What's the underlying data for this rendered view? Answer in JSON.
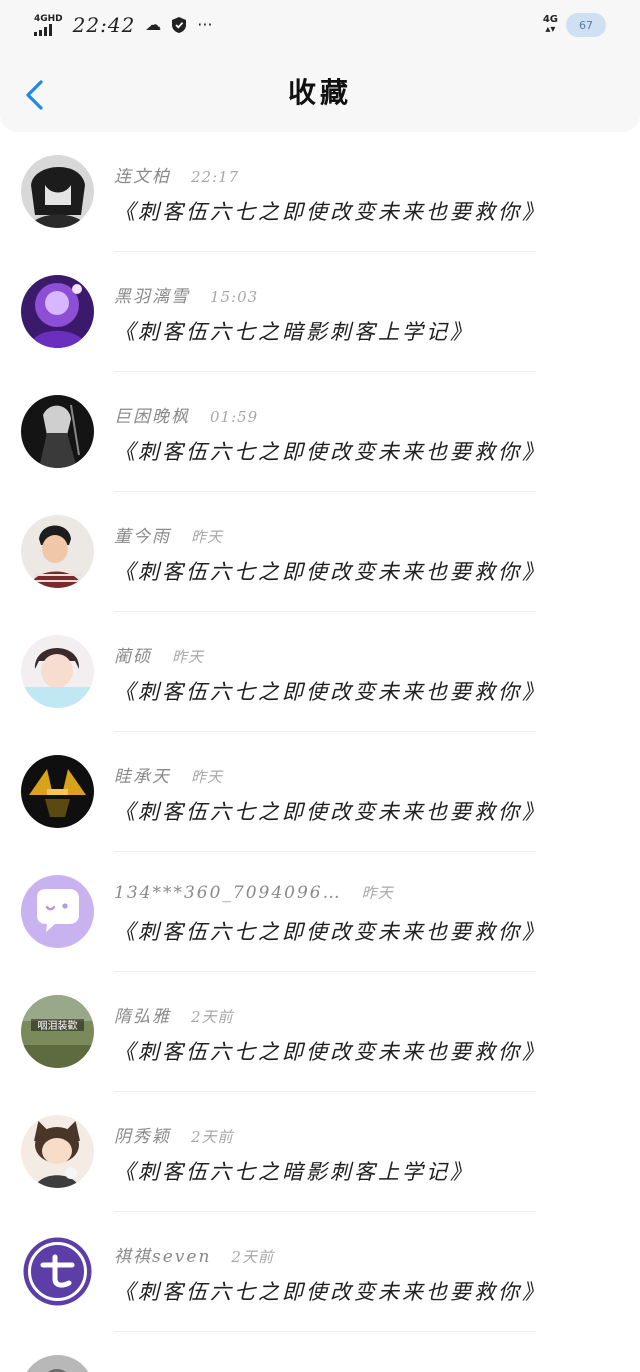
{
  "status_bar": {
    "network_left": "4GHD",
    "time": "22:42",
    "more": "···",
    "network_right": "4G",
    "battery": "67"
  },
  "header": {
    "title": "收藏"
  },
  "colors": {
    "accent": "#1e88e5",
    "divider": "#eeeeee"
  },
  "favorites": [
    {
      "name": "连文柏",
      "time": "22:17",
      "content": "《刺客伍六七之即使改变未来也要救你》",
      "avatar": "dark-anime-avatar"
    },
    {
      "name": "黑羽漓雪",
      "time": "15:03",
      "content": "《刺客伍六七之暗影刺客上学记》",
      "avatar": "purple-anime-avatar"
    },
    {
      "name": "巨困晚枫",
      "time": "01:59",
      "content": "《刺客伍六七之即使改变未来也要救你》",
      "avatar": "dark-figure-avatar"
    },
    {
      "name": "董今雨",
      "time": "昨天",
      "content": "《刺客伍六七之即使改变未来也要救你》",
      "avatar": "boy-photo-avatar"
    },
    {
      "name": "蔺硕",
      "time": "昨天",
      "content": "《刺客伍六七之即使改变未来也要救你》",
      "avatar": "anime-boy-avatar"
    },
    {
      "name": "眭承天",
      "time": "昨天",
      "content": "《刺客伍六七之即使改变未来也要救你》",
      "avatar": "gold-helmet-avatar"
    },
    {
      "name": "134***360_7094096…",
      "time": "昨天",
      "content": "《刺客伍六七之即使改变未来也要救你》",
      "avatar": "default-chat-avatar"
    },
    {
      "name": "隋弘雅",
      "time": "2天前",
      "content": "《刺客伍六七之即使改变未来也要救你》",
      "avatar": "outdoor-photo-avatar",
      "avatar_text": "咽泪装歡"
    },
    {
      "name": "阴秀颖",
      "time": "2天前",
      "content": "《刺客伍六七之暗影刺客上学记》",
      "avatar": "chibi-cat-boy-avatar"
    },
    {
      "name": "祺祺seven",
      "time": "2天前",
      "content": "《刺客伍六七之即使改变未来也要救你》",
      "avatar": "purple-logo-avatar"
    }
  ]
}
